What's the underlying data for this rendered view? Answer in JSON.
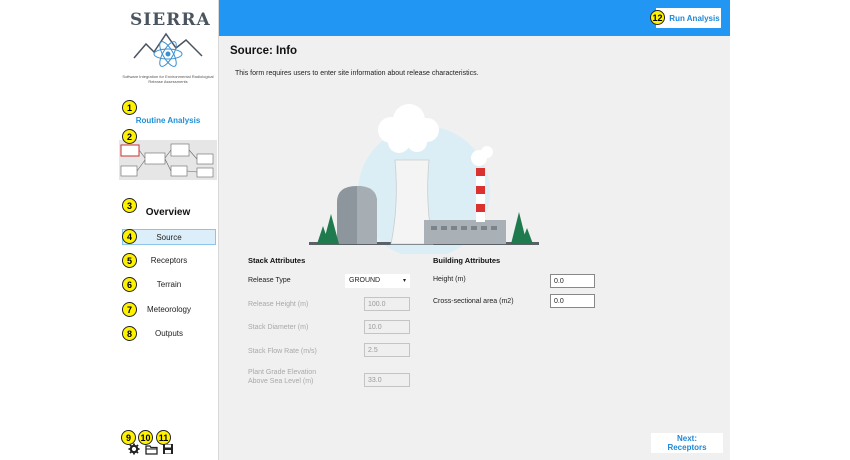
{
  "app": {
    "logo_title": "SIERRA",
    "logo_subtitle": "Software Integration for Environmental Radiological Release Assessments",
    "mode_label": "Routine Analysis",
    "overview_label": "Overview",
    "nav_items": [
      {
        "label": "Source",
        "active": true
      },
      {
        "label": "Receptors",
        "active": false
      },
      {
        "label": "Terrain",
        "active": false
      },
      {
        "label": "Meteorology",
        "active": false
      },
      {
        "label": "Outputs",
        "active": false
      }
    ]
  },
  "badges": [
    "1",
    "2",
    "3",
    "4",
    "5",
    "6",
    "7",
    "8",
    "9",
    "10",
    "11",
    "12"
  ],
  "toolbar": {
    "run_label": "Run Analysis"
  },
  "page": {
    "title": "Source: Info",
    "description": "This form requires users to enter site information about release characteristics."
  },
  "stack": {
    "section_title": "Stack Attributes",
    "release_type_label": "Release Type",
    "release_type_value": "GROUND",
    "release_height_label": "Release Height (m)",
    "release_height_value": "100.0",
    "stack_diameter_label": "Stack Diameter (m)",
    "stack_diameter_value": "10.0",
    "flow_rate_label": "Stack Flow Rate (m/s)",
    "flow_rate_value": "2.5",
    "elevation_label_1": "Plant Grade Elevation",
    "elevation_label_2": "Above Sea Level (m)",
    "elevation_value": "33.0"
  },
  "building": {
    "section_title": "Building Attributes",
    "height_label": "Height (m)",
    "height_value": "0.0",
    "area_label": "Cross-sectional area (m2)",
    "area_value": "0.0"
  },
  "footer": {
    "next_label": "Next: Receptors"
  },
  "colors": {
    "accent": "#2196f3",
    "badge": "#fff200",
    "link": "#1e88d8"
  }
}
